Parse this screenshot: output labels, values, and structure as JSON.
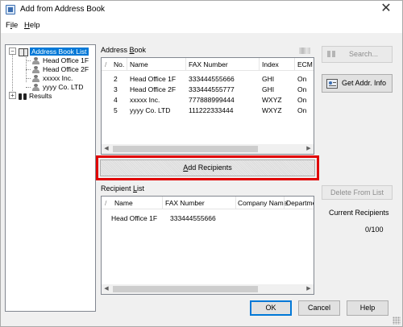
{
  "window": {
    "title": "Add from Address Book",
    "close_glyph": "✕"
  },
  "menu": {
    "file": {
      "label_u": "i",
      "label_pre": "F",
      "label_post": "le"
    },
    "help": {
      "label_u": "H",
      "label_post": "elp"
    }
  },
  "tree": {
    "root": "Address Book List",
    "children": [
      "Head Office 1F",
      "Head Office 2F",
      "xxxxx Inc.",
      "yyyy Co. LTD"
    ],
    "results": "Results",
    "expander_root": "−",
    "expander_results": "+"
  },
  "address_book": {
    "label_pre": "Address ",
    "label_u": "B",
    "label_post": "ook",
    "columns": [
      "No.",
      "Name",
      "FAX Number",
      "Index",
      "ECM"
    ],
    "rows": [
      {
        "no": "2",
        "name": "Head Office 1F",
        "fax": "333444555666",
        "index": "GHI",
        "ecm": "On"
      },
      {
        "no": "3",
        "name": "Head Office 2F",
        "fax": "333444555777",
        "index": "GHI",
        "ecm": "On"
      },
      {
        "no": "4",
        "name": "xxxxx Inc.",
        "fax": "777888999444",
        "index": "WXYZ",
        "ecm": "On"
      },
      {
        "no": "5",
        "name": "yyyy Co. LTD",
        "fax": "111222333444",
        "index": "WXYZ",
        "ecm": "On"
      }
    ]
  },
  "buttons": {
    "search": "Search...",
    "get_addr_info": "Get Addr. Info",
    "add_recipients_u": "A",
    "add_recipients_post": "dd Recipients",
    "delete_from_list": "Delete From List",
    "ok": "OK",
    "cancel": "Cancel",
    "help": "Help"
  },
  "recipient_list": {
    "label_pre": "Recipient ",
    "label_u": "L",
    "label_post": "ist",
    "columns": [
      "Name",
      "FAX Number",
      "Company Name",
      "Departmen"
    ],
    "rows": [
      {
        "name": "Head Office 1F",
        "fax": "333444555666"
      }
    ]
  },
  "current_recipients": {
    "label": "Current Recipients",
    "count": "0/100"
  },
  "scroll": {
    "left": "◀",
    "right": "▶"
  }
}
